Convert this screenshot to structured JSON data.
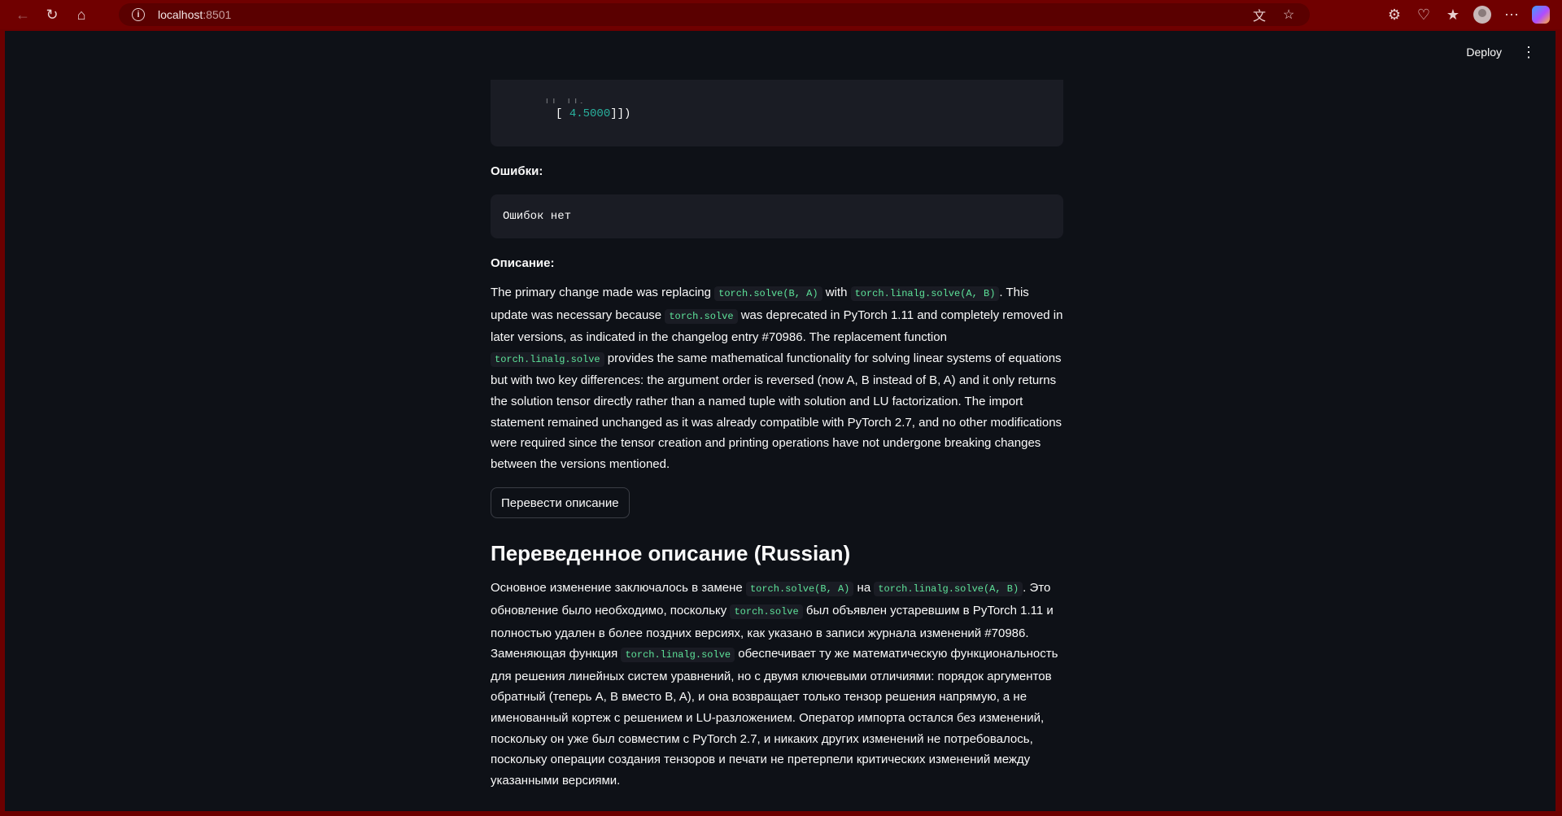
{
  "browser": {
    "url_host": "localhost",
    "url_port": ":8501"
  },
  "app": {
    "deploy_label": "Deploy"
  },
  "code_output": {
    "partial_line": "[[  ]],",
    "line_prefix": "[ ",
    "line_number": "4.5000",
    "line_suffix": "]])"
  },
  "errors": {
    "heading": "Ошибки:",
    "text": "Ошибок нет"
  },
  "description": {
    "heading": "Описание:",
    "p1": "The primary change made was replacing ",
    "c1": "torch.solve(B, A)",
    "p2": " with ",
    "c2": "torch.linalg.solve(A, B)",
    "p3": ". This update was necessary because ",
    "c3": "torch.solve",
    "p4": " was deprecated in PyTorch 1.11 and completely removed in later versions, as indicated in the changelog entry #70986. The replacement function ",
    "c4": "torch.linalg.solve",
    "p5": " provides the same mathematical functionality for solving linear systems of equations but with two key differences: the argument order is reversed (now A, B instead of B, A) and it only returns the solution tensor directly rather than a named tuple with solution and LU factorization. The import statement remained unchanged as it was already compatible with PyTorch 2.7, and no other modifications were required since the tensor creation and printing operations have not undergone breaking changes between the versions mentioned."
  },
  "translate_button": "Перевести описание",
  "translated": {
    "heading": "Переведенное описание (Russian)",
    "p1": "Основное изменение заключалось в замене ",
    "c1": "torch.solve(B, A)",
    "p2": " на ",
    "c2": "torch.linalg.solve(A, B)",
    "p3": ". Это обновление было необходимо, поскольку ",
    "c3": "torch.solve",
    "p4": " был объявлен устаревшим в PyTorch 1.11 и полностью удален в более поздних версиях, как указано в записи журнала изменений #70986. Заменяющая функция ",
    "c4": "torch.linalg.solve",
    "p5": " обеспечивает ту же математическую функциональность для решения линейных систем уравнений, но с двумя ключевыми отличиями: порядок аргументов обратный (теперь A, B вместо B, A), и она возвращает только тензор решения напрямую, а не именованный кортеж с решением и LU-разложением. Оператор импорта остался без изменений, поскольку он уже был совместим с PyTorch 2.7, и никаких других изменений не потребовалось, поскольку операции создания тензоров и печати не претерпели критических изменений между указанными версиями."
  }
}
